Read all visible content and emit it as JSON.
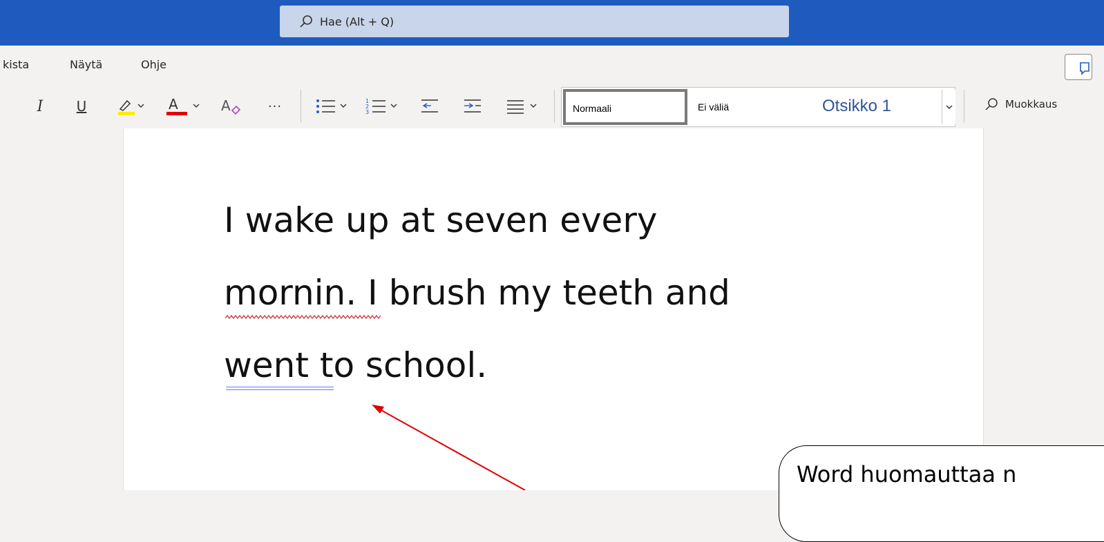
{
  "search": {
    "placeholder": "Hae (Alt + Q)"
  },
  "menu": {
    "items": [
      {
        "label": "kista"
      },
      {
        "label": "Näytä"
      },
      {
        "label": "Ohje"
      }
    ]
  },
  "toolbar": {
    "more_label": "···"
  },
  "styles": {
    "normal": "Normaali",
    "no_spacing": "Ei väliä",
    "heading1": "Otsikko 1"
  },
  "edit_mode": {
    "label": "Muokkaus"
  },
  "document": {
    "line1": "I wake up at seven every",
    "line2_misspelled": "mornin",
    "line2_rest": ". I brush my teeth and",
    "line3_flagged": "went",
    "line3_rest": " to school."
  },
  "callout": {
    "text": "Word huomauttaa n"
  },
  "colors": {
    "titlebar": "#1f5bbf",
    "highlight": "#ffeb00",
    "font_color": "#e00000",
    "spelling": "#d13438",
    "grammar": "#5b7de8",
    "arrow": "#e00000"
  }
}
